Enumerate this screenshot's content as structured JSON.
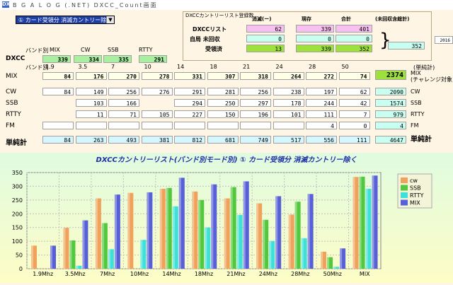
{
  "window": {
    "icon_text": "DX",
    "title": "B G A L O G (.NET)  DXCC_Count画面"
  },
  "selector": {
    "value": "① カード受領分  消滅カントリー除く"
  },
  "summary_box": {
    "heading": "DXCCカントリーリスト登録数",
    "col_headers": [
      "消滅(ー)",
      "現存",
      "合計",
      "(未回収含総計)"
    ],
    "rows": [
      {
        "label": "DXCCリスト",
        "values": [
          "62",
          "339",
          "401"
        ]
      },
      {
        "label": "自局  未回収",
        "values": [
          "0",
          "0",
          "0"
        ]
      },
      {
        "label": "受領済",
        "values": [
          "13",
          "339",
          "352"
        ]
      }
    ],
    "grand_total": "352",
    "side_value": "2016"
  },
  "dxcc_row": {
    "band_header": "バンド別",
    "mode_headers": [
      "MIX",
      "CW",
      "SSB",
      "RTTY"
    ],
    "label": "DXCC",
    "values": [
      "339",
      "334",
      "335",
      "291"
    ]
  },
  "band_table": {
    "band_header": "バンド別",
    "bands": [
      "1.9",
      "3.5",
      "7",
      "10",
      "14",
      "18",
      "21",
      "24",
      "28",
      "50"
    ],
    "total_header": "(単純計)",
    "rows": [
      {
        "label": "MIX",
        "values": [
          "84",
          "176",
          "270",
          "278",
          "331",
          "307",
          "318",
          "264",
          "272",
          "74"
        ],
        "total": "2374",
        "note": "MIX\n(チャレンジ対象)"
      },
      {
        "label": "CW",
        "values": [
          "84",
          "149",
          "256",
          "276",
          "291",
          "281",
          "256",
          "238",
          "197",
          "62"
        ],
        "total": "2090",
        "note": "CW"
      },
      {
        "label": "SSB",
        "values": [
          "",
          "103",
          "166",
          "",
          "294",
          "250",
          "297",
          "178",
          "244",
          "42"
        ],
        "total": "1574",
        "note": "SSB"
      },
      {
        "label": "RTTY",
        "values": [
          "",
          "11",
          "71",
          "105",
          "227",
          "150",
          "196",
          "101",
          "111",
          "7"
        ],
        "total": "979",
        "note": "RTTY"
      },
      {
        "label": "FM",
        "values": [
          "",
          "",
          "",
          "",
          "",
          "",
          "",
          "",
          "4",
          "0"
        ],
        "total": "4",
        "note": "FM"
      },
      {
        "label": "単純計",
        "values": [
          "84",
          "263",
          "493",
          "381",
          "812",
          "681",
          "749",
          "517",
          "556",
          "111"
        ],
        "total": "4647",
        "note": "単純計"
      }
    ]
  },
  "colors": {
    "cw": "#f0a25a",
    "ssb": "#52c83e",
    "rtty": "#3fe0d8",
    "mix": "#5860d8"
  },
  "chart_data": {
    "type": "bar",
    "title": "DXCCカントリーリスト(バンド別モード別)    ① カード受領分  消滅カントリー除く",
    "categories": [
      "1.9Mhz",
      "3.5Mhz",
      "7Mhz",
      "10Mhz",
      "14Mhz",
      "18Mhz",
      "21Mhz",
      "24Mhz",
      "28Mhz",
      "50Mhz",
      "MIX"
    ],
    "series": [
      {
        "name": "cw",
        "values": [
          84,
          149,
          256,
          276,
          291,
          281,
          256,
          238,
          197,
          62,
          334
        ]
      },
      {
        "name": "SSB",
        "values": [
          0,
          103,
          166,
          0,
          294,
          250,
          297,
          178,
          244,
          42,
          335
        ]
      },
      {
        "name": "RTTY",
        "values": [
          0,
          11,
          71,
          105,
          227,
          150,
          196,
          101,
          111,
          7,
          291
        ]
      },
      {
        "name": "MIX",
        "values": [
          84,
          176,
          270,
          278,
          331,
          307,
          318,
          264,
          272,
          74,
          339
        ]
      }
    ],
    "yticks": [
      "0",
      "50",
      "100",
      "150",
      "200",
      "250",
      "300",
      "350"
    ],
    "ylim": [
      0,
      350
    ],
    "grid": true,
    "legend": "top-right"
  }
}
